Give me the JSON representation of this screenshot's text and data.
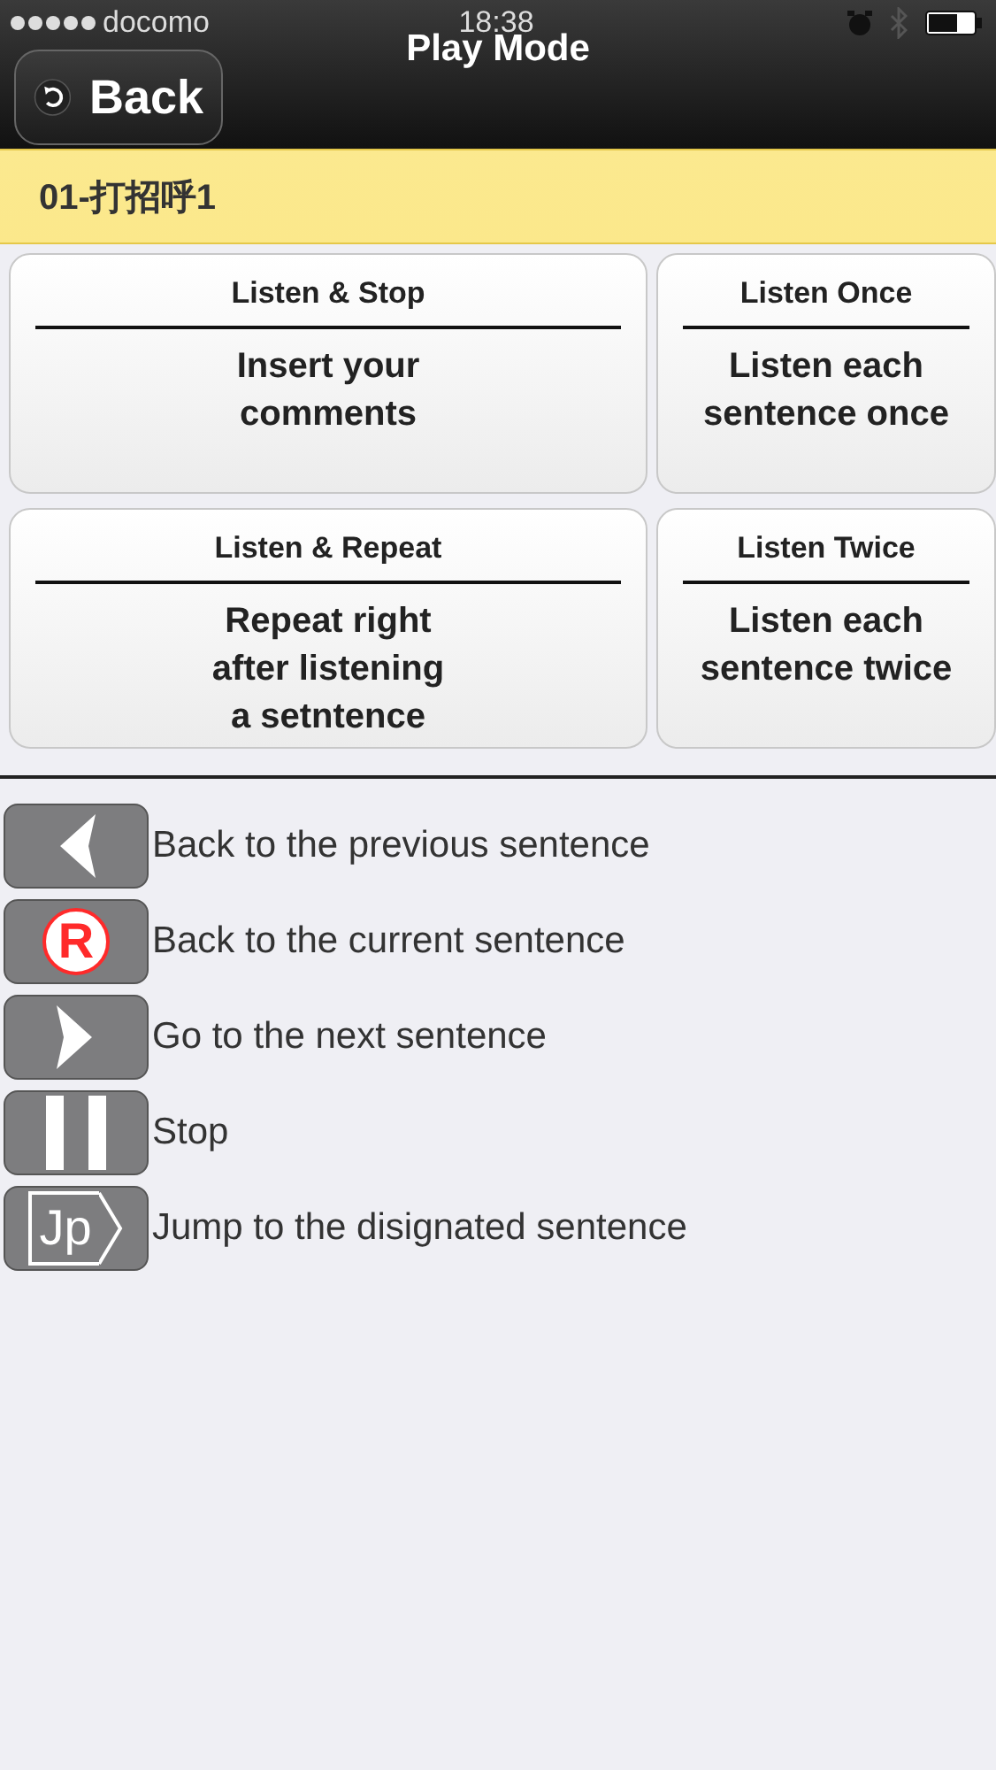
{
  "status_bar": {
    "carrier": "docomo",
    "time": "18:38"
  },
  "nav": {
    "back": "Back",
    "title": "Play Mode"
  },
  "lesson": {
    "title": "01-打招呼1"
  },
  "modes": [
    {
      "title": "Listen & Stop",
      "description": "Insert your comments"
    },
    {
      "title": "Listen Once",
      "description": "Listen each sentence once"
    },
    {
      "title": "Listen & Repeat",
      "description": "Repeat right after listening a setntence"
    },
    {
      "title": "Listen Twice",
      "description": "Listen each sentence twice"
    }
  ],
  "legend": [
    {
      "kind": "previous",
      "label": "Back to the previous sentence"
    },
    {
      "kind": "current",
      "glyph": "R",
      "label": "Back to the current sentence"
    },
    {
      "kind": "next",
      "label": "Go to the next sentence"
    },
    {
      "kind": "stop",
      "label": "Stop"
    },
    {
      "kind": "jump",
      "glyph": "Jp",
      "label": "Jump to the disignated sentence"
    }
  ]
}
